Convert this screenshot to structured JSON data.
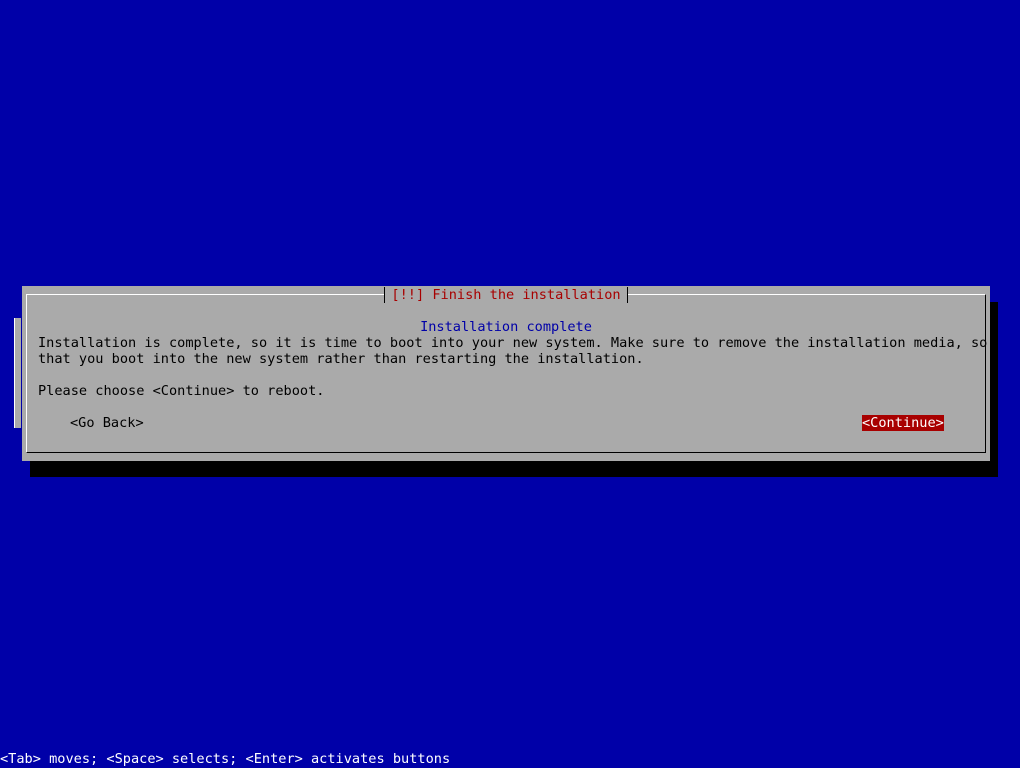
{
  "dialog": {
    "title": "[!!] Finish the installation",
    "subtitle": "Installation complete",
    "line1": "Installation is complete, so it is time to boot into your new system. Make sure to remove the installation media, so",
    "line2": "that you boot into the new system rather than restarting the installation.",
    "line3": "Please choose <Continue> to reboot.",
    "back_label": "<Go Back>",
    "continue_label": "<Continue>"
  },
  "help_bar": {
    "text": "<Tab> moves; <Space> selects; <Enter> activates buttons"
  },
  "colors": {
    "background": "#0000a8",
    "dialog": "#aaaaaa",
    "title_text": "#a80000",
    "subtitle_text": "#0000a8",
    "selected_button_bg": "#a80000",
    "selected_button_text": "#ffffff"
  }
}
